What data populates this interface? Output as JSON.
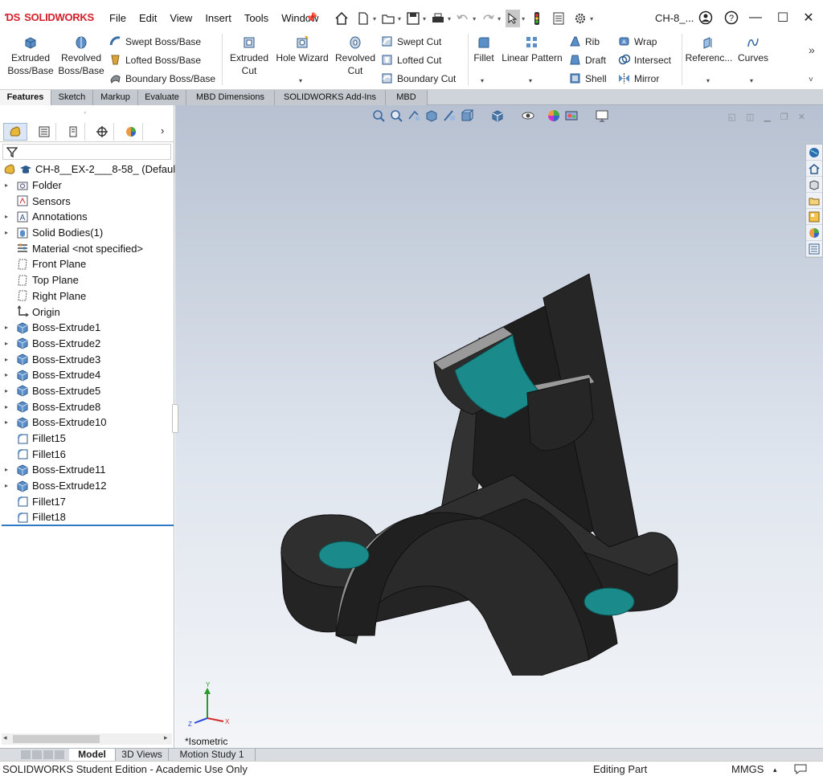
{
  "app": {
    "logo": "SOLIDWORKS",
    "menu": [
      "File",
      "Edit",
      "View",
      "Insert",
      "Tools",
      "Window"
    ],
    "document_title": "CH-8_..."
  },
  "ribbon": {
    "extruded_boss": "Extruded\nBoss/Base",
    "revolved_boss": "Revolved\nBoss/Base",
    "swept_boss": "Swept Boss/Base",
    "lofted_boss": "Lofted Boss/Base",
    "boundary_boss": "Boundary Boss/Base",
    "extruded_cut": "Extruded\nCut",
    "hole_wizard": "Hole Wizard",
    "revolved_cut": "Revolved\nCut",
    "swept_cut": "Swept Cut",
    "lofted_cut": "Lofted Cut",
    "boundary_cut": "Boundary Cut",
    "fillet": "Fillet",
    "linear_pattern": "Linear Pattern",
    "rib": "Rib",
    "draft": "Draft",
    "shell": "Shell",
    "wrap": "Wrap",
    "intersect": "Intersect",
    "mirror": "Mirror",
    "reference": "Referenc...",
    "curves": "Curves"
  },
  "tabs": [
    {
      "label": "Features",
      "active": true
    },
    {
      "label": "Sketch"
    },
    {
      "label": "Markup"
    },
    {
      "label": "Evaluate"
    },
    {
      "label": "MBD Dimensions"
    },
    {
      "label": "SOLIDWORKS Add-Ins"
    },
    {
      "label": "MBD"
    }
  ],
  "tree": {
    "root": "CH-8__EX-2___8-58_ (Defaul",
    "items": [
      {
        "label": "Folder",
        "expandable": true,
        "icon": "folder"
      },
      {
        "label": "Sensors",
        "expandable": false,
        "icon": "sensor"
      },
      {
        "label": "Annotations",
        "expandable": true,
        "icon": "annotation"
      },
      {
        "label": "Solid Bodies(1)",
        "expandable": true,
        "icon": "solid-bodies"
      },
      {
        "label": "Material <not specified>",
        "expandable": false,
        "icon": "material"
      },
      {
        "label": "Front Plane",
        "expandable": false,
        "icon": "plane"
      },
      {
        "label": "Top Plane",
        "expandable": false,
        "icon": "plane"
      },
      {
        "label": "Right Plane",
        "expandable": false,
        "icon": "plane"
      },
      {
        "label": "Origin",
        "expandable": false,
        "icon": "origin"
      },
      {
        "label": "Boss-Extrude1",
        "expandable": true,
        "icon": "extrude"
      },
      {
        "label": "Boss-Extrude2",
        "expandable": true,
        "icon": "extrude"
      },
      {
        "label": "Boss-Extrude3",
        "expandable": true,
        "icon": "extrude"
      },
      {
        "label": "Boss-Extrude4",
        "expandable": true,
        "icon": "extrude"
      },
      {
        "label": "Boss-Extrude5",
        "expandable": true,
        "icon": "extrude"
      },
      {
        "label": "Boss-Extrude8",
        "expandable": true,
        "icon": "extrude"
      },
      {
        "label": "Boss-Extrude10",
        "expandable": true,
        "icon": "extrude"
      },
      {
        "label": "Fillet15",
        "expandable": false,
        "icon": "fillet"
      },
      {
        "label": "Fillet16",
        "expandable": false,
        "icon": "fillet"
      },
      {
        "label": "Boss-Extrude11",
        "expandable": true,
        "icon": "extrude"
      },
      {
        "label": "Boss-Extrude12",
        "expandable": true,
        "icon": "extrude"
      },
      {
        "label": "Fillet17",
        "expandable": false,
        "icon": "fillet"
      },
      {
        "label": "Fillet18",
        "expandable": false,
        "icon": "fillet"
      }
    ]
  },
  "viewport": {
    "view_label": "*Isometric",
    "triad": {
      "x": "X",
      "y": "Y",
      "z": "Z"
    },
    "colors": {
      "body": "#2b2b2b",
      "face_highlight": "#1a8a8a",
      "edge_face": "#8f8f8f"
    }
  },
  "bottom_tabs": [
    {
      "label": "Model",
      "active": true
    },
    {
      "label": "3D Views"
    },
    {
      "label": "Motion Study 1"
    }
  ],
  "status": {
    "edition": "SOLIDWORKS Student Edition - Academic Use Only",
    "mode": "Editing Part",
    "units": "MMGS"
  }
}
